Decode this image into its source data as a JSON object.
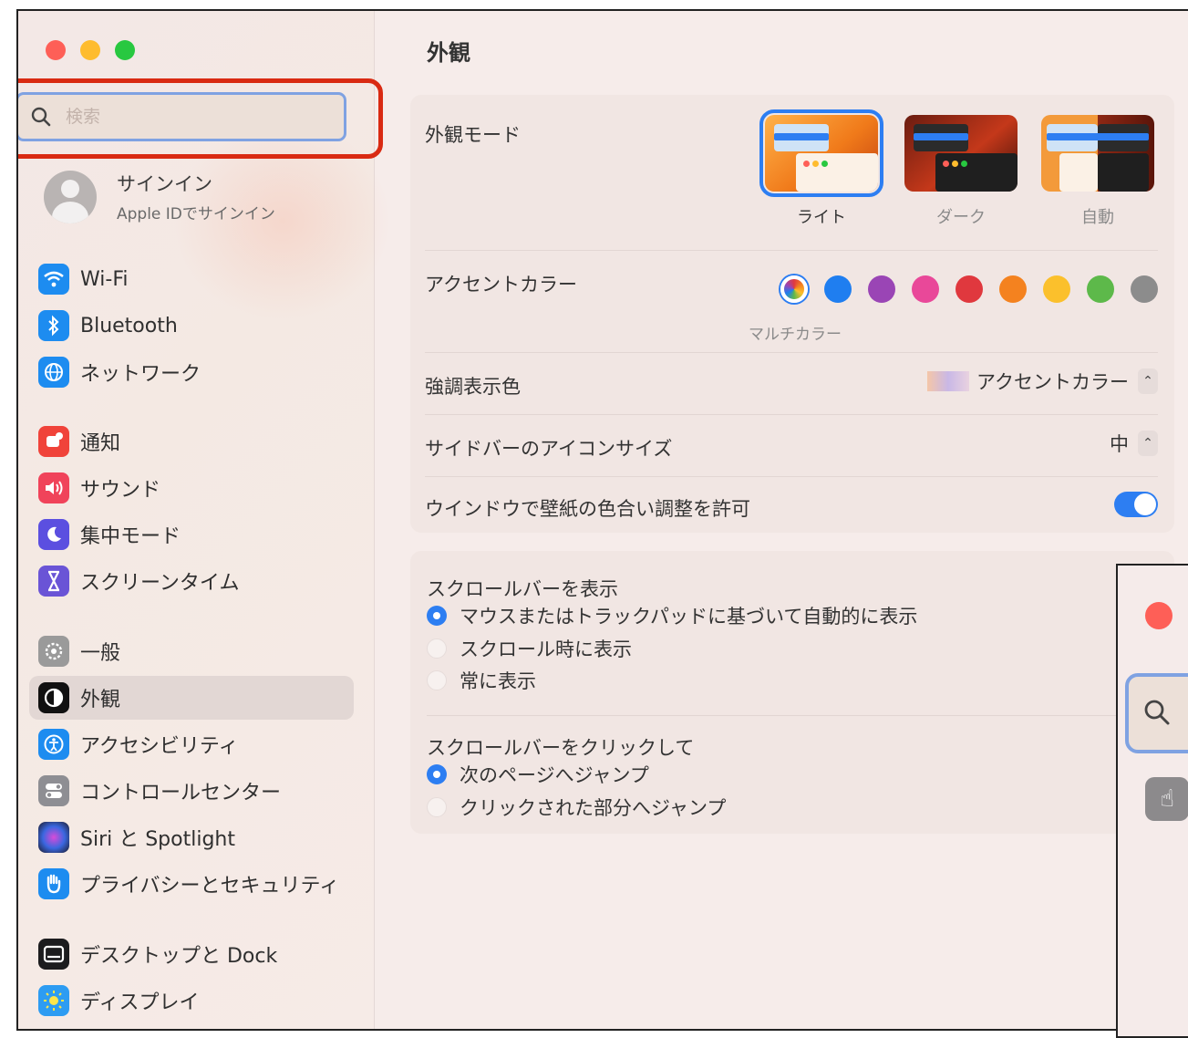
{
  "search": {
    "placeholder": "検索"
  },
  "account": {
    "name": "サインイン",
    "subtitle": "Apple IDでサインイン"
  },
  "sidebar": {
    "items": [
      {
        "label": "Wi-Fi",
        "icon": "wifi-icon",
        "color": "#1d8cf0"
      },
      {
        "label": "Bluetooth",
        "icon": "bluetooth-icon",
        "color": "#1d8cf0"
      },
      {
        "label": "ネットワーク",
        "icon": "globe-icon",
        "color": "#1d8cf0"
      },
      {
        "label": "通知",
        "icon": "bell-icon",
        "color": "#f0433a"
      },
      {
        "label": "サウンド",
        "icon": "speaker-icon",
        "color": "#f0435a"
      },
      {
        "label": "集中モード",
        "icon": "moon-icon",
        "color": "#5b4fe0"
      },
      {
        "label": "スクリーンタイム",
        "icon": "hourglass-icon",
        "color": "#6a54d6"
      },
      {
        "label": "一般",
        "icon": "gear-icon",
        "color": "#9a9a9a"
      },
      {
        "label": "外観",
        "icon": "appearance-icon",
        "color": "#111111"
      },
      {
        "label": "アクセシビリティ",
        "icon": "accessibility-icon",
        "color": "#1d8cf0"
      },
      {
        "label": "コントロールセンター",
        "icon": "control-center-icon",
        "color": "#8e8e93"
      },
      {
        "label": "Siri と Spotlight",
        "icon": "siri-icon",
        "color": "#3a3a5a"
      },
      {
        "label": "プライバシーとセキュリティ",
        "icon": "hand-icon",
        "color": "#1d8cf0"
      },
      {
        "label": "デスクトップと Dock",
        "icon": "dock-icon",
        "color": "#1c1c1e"
      },
      {
        "label": "ディスプレイ",
        "icon": "sun-icon",
        "color": "#2d9cf2"
      }
    ],
    "selected": "外観"
  },
  "main": {
    "title": "外観",
    "appearance_mode": {
      "label": "外観モード",
      "options": [
        "ライト",
        "ダーク",
        "自動"
      ],
      "selected": "ライト"
    },
    "accent_color": {
      "label": "アクセントカラー",
      "caption": "マルチカラー",
      "colors": [
        "multicolor",
        "#1f7ef0",
        "#9a45b5",
        "#e94899",
        "#e0383e",
        "#f4821f",
        "#fbc02c",
        "#5db94a",
        "#8c8c8c"
      ]
    },
    "highlight": {
      "label": "強調表示色",
      "value": "アクセントカラー"
    },
    "sidebar_icon_size": {
      "label": "サイドバーのアイコンサイズ",
      "value": "中"
    },
    "wallpaper_tint": {
      "label": "ウインドウで壁紙の色合い調整を許可",
      "on": true
    },
    "show_scrollbars": {
      "title": "スクロールバーを表示",
      "options": [
        "マウスまたはトラックパッドに基づいて自動的に表示",
        "スクロール時に表示",
        "常に表示"
      ],
      "selected_index": 0
    },
    "click_scrollbar": {
      "title": "スクロールバーをクリックして",
      "options": [
        "次のページへジャンプ",
        "クリックされた部分へジャンプ"
      ],
      "selected_index": 0
    }
  },
  "colors": {
    "accent": "#2d7ef2",
    "highlight_red": "#d92a12"
  }
}
